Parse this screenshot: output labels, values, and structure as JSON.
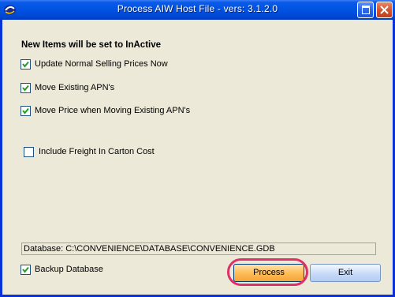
{
  "window": {
    "title": "Process AIW Host File - vers: 3.1.2.0",
    "app_icon": "app-logo-icon",
    "restore_icon": "restore-icon",
    "close_icon": "close-icon"
  },
  "form": {
    "heading": "New Items will be set to InActive",
    "options": [
      {
        "label": "Update Normal Selling Prices Now",
        "checked": true
      },
      {
        "label": "Move Existing APN's",
        "checked": true
      },
      {
        "label": "Move Price when Moving Existing APN's",
        "checked": true
      },
      {
        "label": "Include Freight In Carton Cost",
        "checked": false
      }
    ],
    "database_path": "Database: C:\\CONVENIENCE\\DATABASE\\CONVENIENCE.GDB",
    "backup": {
      "label": "Backup Database",
      "checked": true
    }
  },
  "buttons": {
    "process": "Process",
    "exit": "Exit"
  },
  "colors": {
    "title_bar": "#0054e3",
    "highlight_ring": "#e0306a",
    "process_button": "#ffc060"
  }
}
